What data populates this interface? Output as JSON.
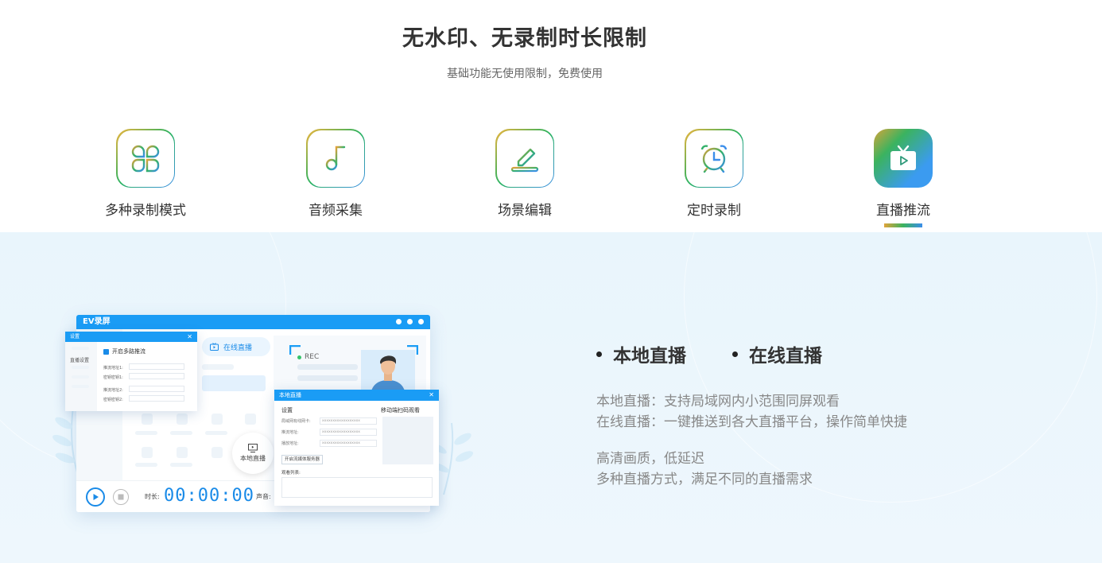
{
  "header": {
    "title": "无水印、无录制时长限制",
    "subtitle": "基础功能无使用限制，免费使用"
  },
  "features": [
    {
      "label": "多种录制模式",
      "icon": "grid-modes-icon"
    },
    {
      "label": "音频采集",
      "icon": "music-note-icon"
    },
    {
      "label": "场景编辑",
      "icon": "pencil-edit-icon"
    },
    {
      "label": "定时录制",
      "icon": "alarm-clock-icon"
    },
    {
      "label": "直播推流",
      "icon": "tv-live-icon",
      "active": true
    }
  ],
  "detail": {
    "bullet1": "本地直播",
    "bullet2": "在线直播",
    "line1": "本地直播：支持局域网内小范围同屏观看",
    "line2": "在线直播：一键推送到各大直播平台，操作简单快捷",
    "line3": "高清画质，低延迟",
    "line4": "多种直播方式，满足不同的直播需求"
  },
  "mockup": {
    "app_title": "EV录屏",
    "tab_live": "在线直播",
    "rec": "REC",
    "local_button": "本地直播",
    "duration_label": "时长:",
    "timer": "00:00:00",
    "volume_label": "声音:",
    "settings": {
      "title": "设置",
      "side_label": "直播设置",
      "checkbox": "开启多路推流",
      "fields": [
        "推流地址1:",
        "密钥密钥1:",
        "推流地址2:",
        "密钥密钥2:"
      ]
    },
    "local_popup": {
      "title": "本地直播",
      "section": "设置",
      "qr_label": "移动端扫码观看",
      "fields": [
        "局域网有线网卡:",
        "推流地址:",
        "播放地址:"
      ],
      "field_value": "xxxxxxxxxxxxxxxxxx",
      "server_button": "开启流媒体服务器",
      "viewers_label": "观看列表:"
    }
  },
  "colors": {
    "accent": "#1a9cf5",
    "section_bg": "#e9f5fc"
  }
}
